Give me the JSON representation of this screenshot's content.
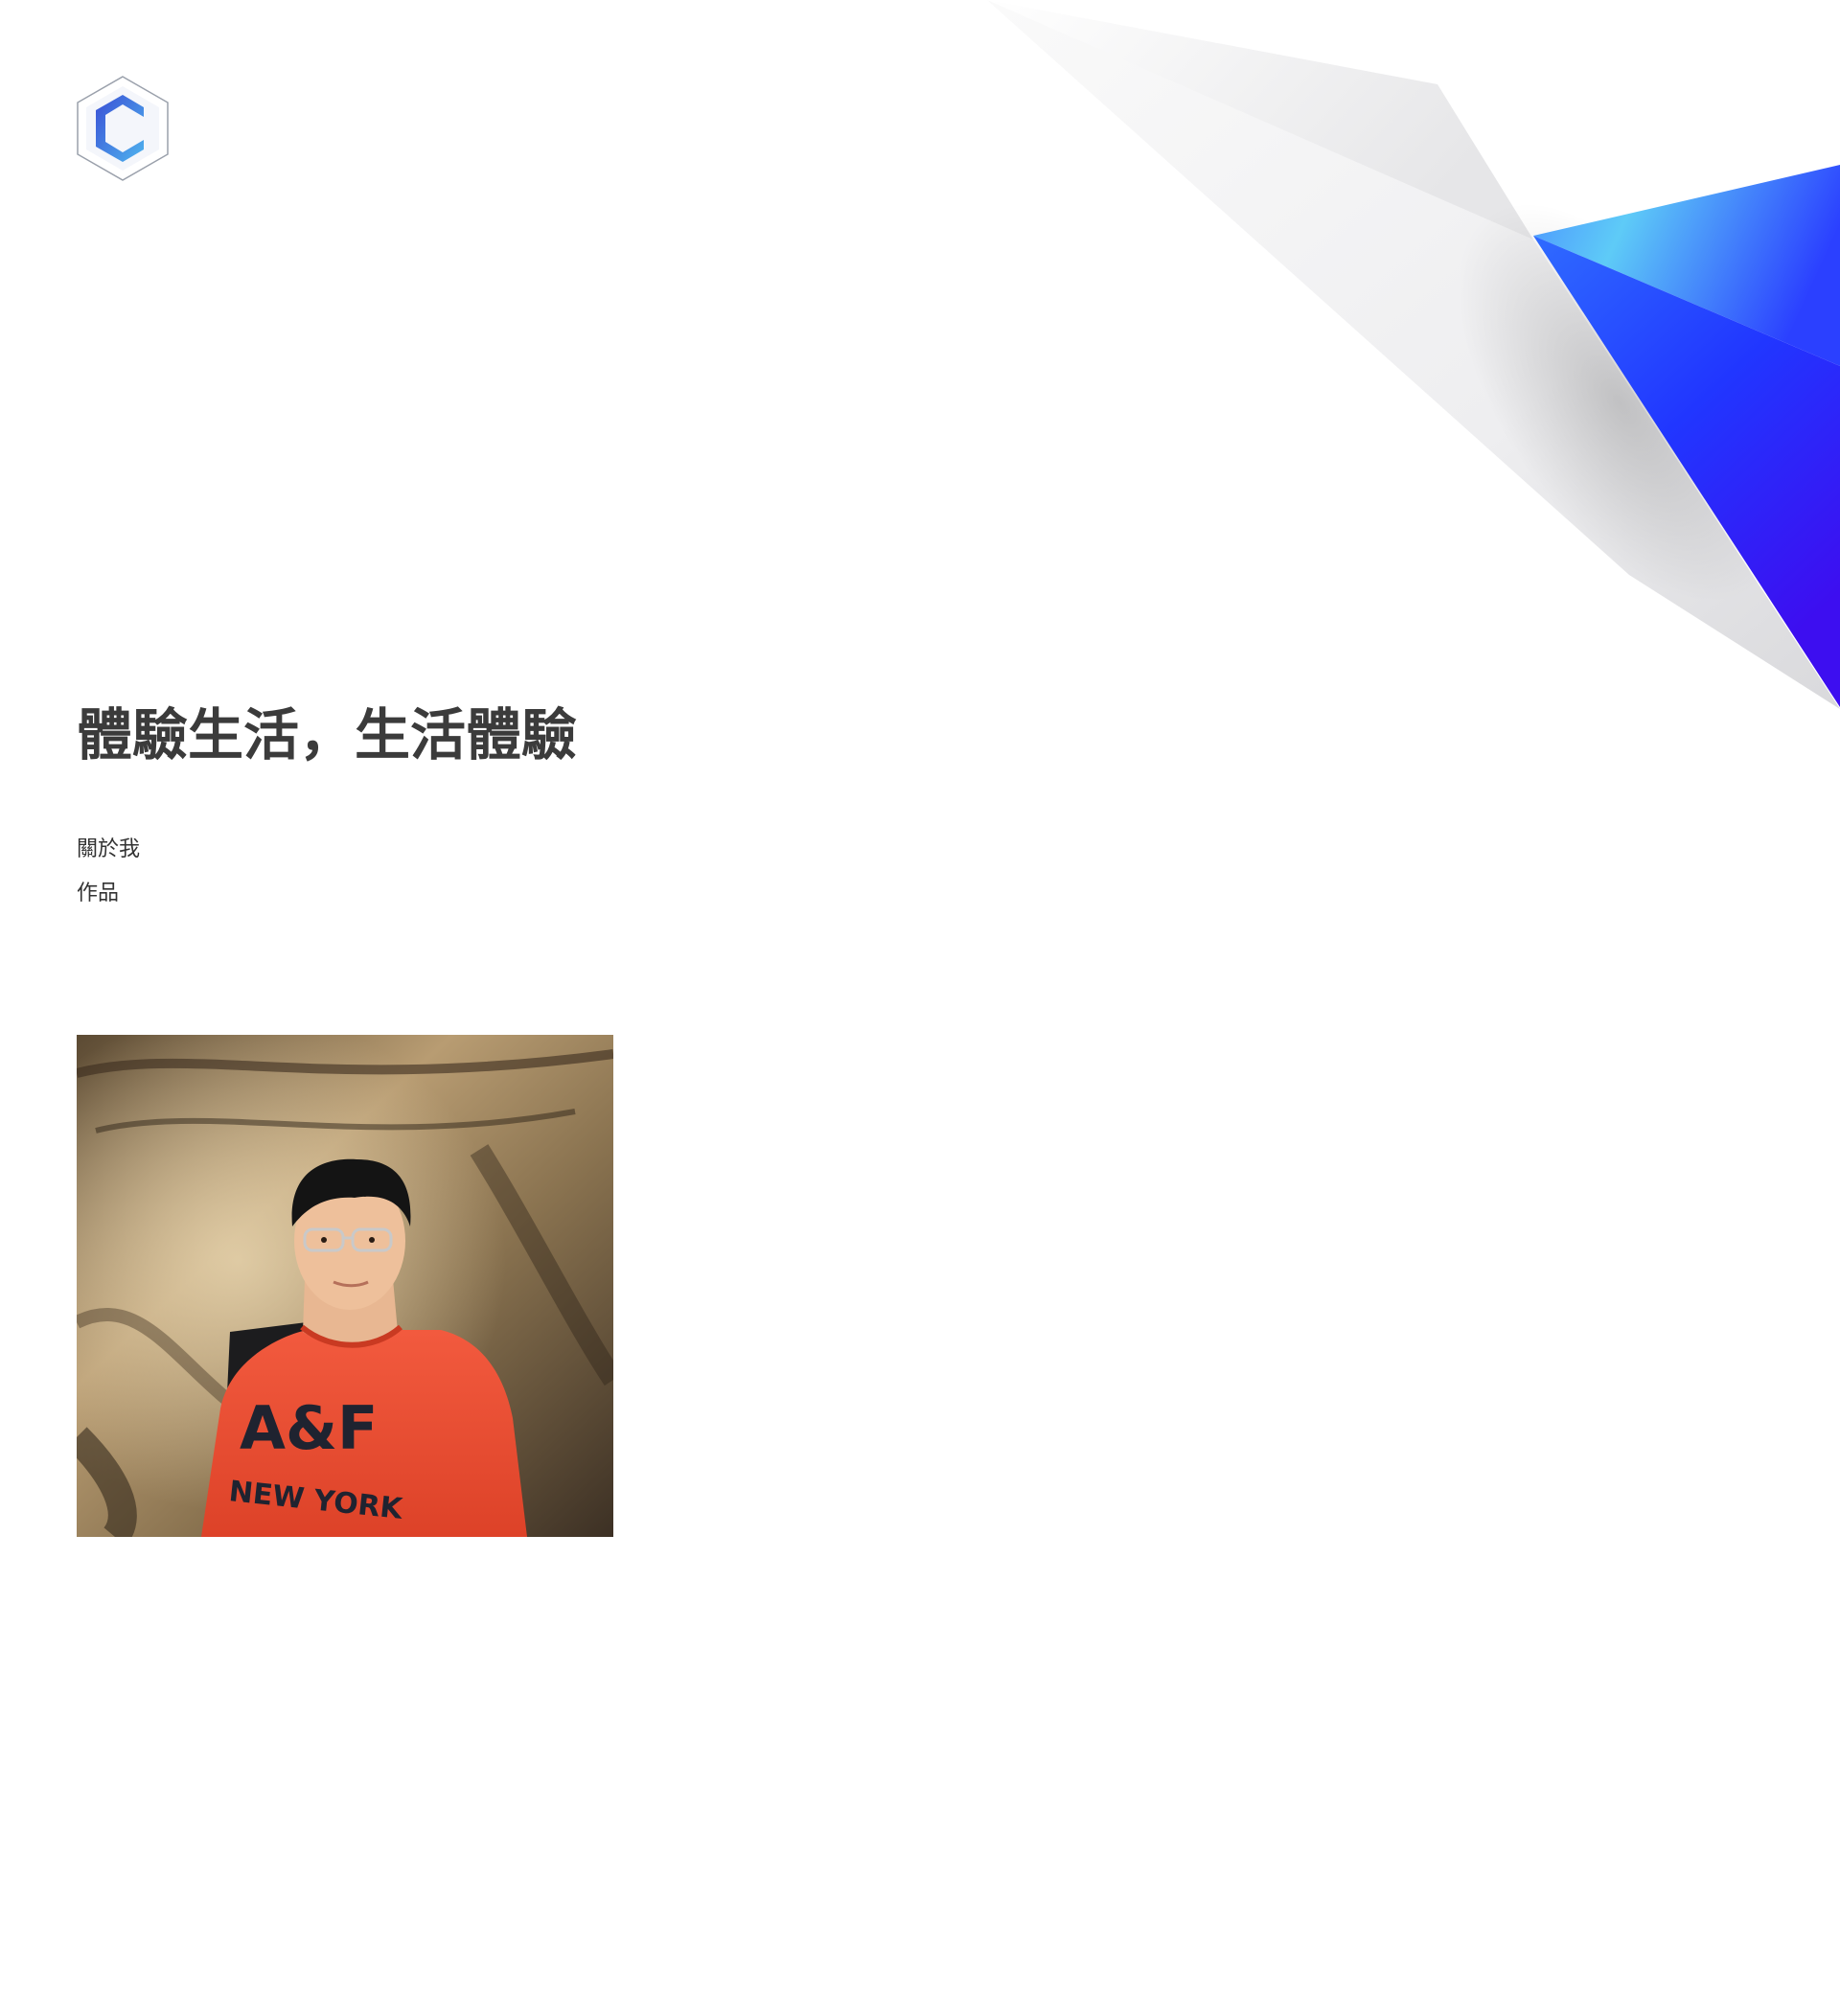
{
  "hero": {
    "title": "體驗生活，生活體驗"
  },
  "nav": {
    "items": [
      {
        "label": "關於我"
      },
      {
        "label": "作品"
      }
    ]
  },
  "photo": {
    "shirt_text_line1": "A&F",
    "shirt_text_line2": "NEW YORK"
  },
  "colors": {
    "accent_blue": "#2a3cff",
    "accent_violet": "#3a10f0",
    "accent_cyan": "#55c8f5",
    "headline": "#3b3b3b",
    "text": "#333333"
  },
  "icons": {
    "logo": "hexagon-c-logo-icon"
  }
}
